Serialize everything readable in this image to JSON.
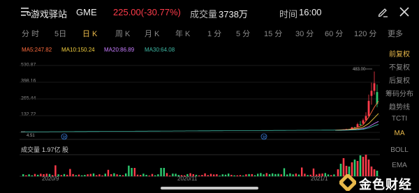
{
  "header": {
    "stock_name": "游戏驿站",
    "ticker": "GME",
    "price_change": "225.00(-30.77%)",
    "volume_label": "成交量",
    "volume_value": "3738万",
    "time_label": "时间",
    "time_value": "16:00",
    "icons": [
      "menu-icon",
      "edit-icon",
      "close-icon"
    ]
  },
  "tabs": [
    {
      "label": "分 时",
      "active": false
    },
    {
      "label": "5日",
      "active": false
    },
    {
      "label": "日 K",
      "active": true
    },
    {
      "label": "周 K",
      "active": false
    },
    {
      "label": "月 K",
      "active": false
    },
    {
      "label": "年 K",
      "active": false
    },
    {
      "label": "1 分",
      "active": false
    },
    {
      "label": "5 分",
      "active": false
    },
    {
      "label": "15 分",
      "active": false
    },
    {
      "label": "30 分",
      "active": false
    },
    {
      "label": "60 分",
      "active": false
    },
    {
      "label": "120 分",
      "active": false
    },
    {
      "label": "更多",
      "active": false
    }
  ],
  "ma_legend": [
    {
      "label": "MA5:247.82",
      "color": "#ff6b3d"
    },
    {
      "label": "MA10:150.24",
      "color": "#f4d03f"
    },
    {
      "label": "MA20:86.89",
      "color": "#c77dff"
    },
    {
      "label": "MA30:64.08",
      "color": "#3fb9a5"
    }
  ],
  "right_panel": [
    {
      "label": "前复权",
      "active": true
    },
    {
      "label": "不复权",
      "active": false
    },
    {
      "label": "后复权",
      "active": false
    },
    {
      "label": "筹码分布",
      "active": false
    },
    {
      "label": "趋势线",
      "active": false
    },
    {
      "label": "TCTI",
      "active": false
    },
    {
      "label": "MA",
      "active": true
    },
    {
      "label": "BOLL",
      "active": false
    },
    {
      "label": "EMA",
      "active": false
    }
  ],
  "price_axis": [
    "530.87",
    "398.16",
    "265.44",
    "132.72"
  ],
  "annotations": {
    "high_marker": "483.00",
    "low_marker": "4.51",
    "event_marker": "财"
  },
  "volume": {
    "label": "成交量",
    "value": "1.97亿 股"
  },
  "x_axis": [
    "2020/9",
    "2020/11",
    "2021/1"
  ],
  "colors": {
    "up": "#ff3b4a",
    "down": "#2ecc71",
    "accent": "#e8b84a",
    "background": "#000000"
  },
  "watermark": {
    "text": "金色财经"
  },
  "chart_data": {
    "type": "candlestick",
    "series": [
      {
        "name": "MA5",
        "last": 247.82
      },
      {
        "name": "MA10",
        "last": 150.24
      },
      {
        "name": "MA20",
        "last": 86.89
      },
      {
        "name": "MA30",
        "last": 64.08
      }
    ],
    "y_ticks": [
      530.87,
      398.16,
      265.44,
      132.72
    ],
    "ylim": [
      0,
      530.87
    ],
    "high": 483.0,
    "low": 4.51,
    "last_close": 225.0,
    "change_pct": -30.77
  }
}
